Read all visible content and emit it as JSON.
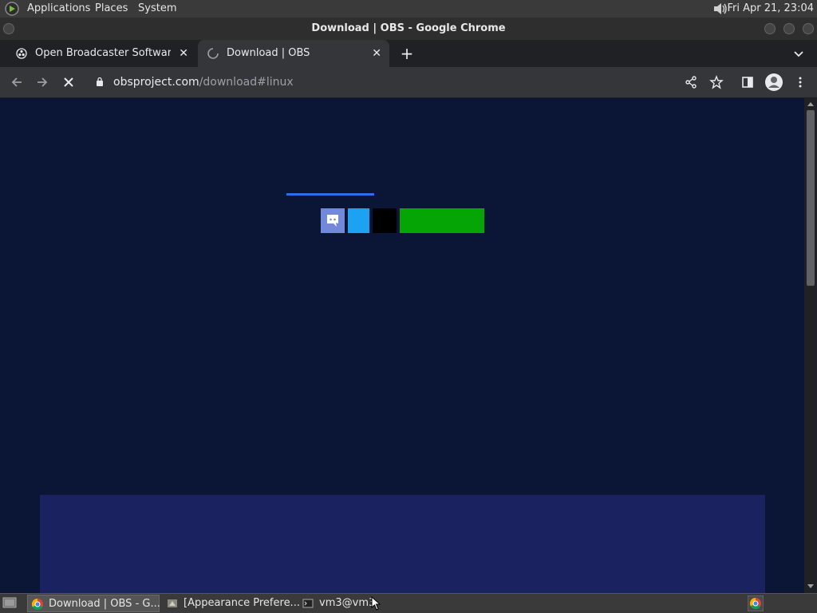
{
  "top_panel": {
    "menus": [
      "Applications",
      "Places",
      "System"
    ],
    "clock": "Fri Apr 21, 23:04"
  },
  "window": {
    "title": "Download | OBS - Google Chrome"
  },
  "tabs": [
    {
      "label": "Open Broadcaster Software | OBS",
      "icon": "obs-favicon",
      "active": false
    },
    {
      "label": "Download | OBS",
      "icon": "loading-spinner-icon",
      "active": true
    }
  ],
  "toolbar": {
    "url_host": "obsproject.com",
    "url_path": "/download#linux"
  },
  "taskbar": {
    "items": [
      {
        "label": "Download | OBS - G...",
        "icon": "chrome-icon",
        "active": true
      },
      {
        "label": "[Appearance Prefere...",
        "icon": "appearance-icon",
        "active": false
      },
      {
        "label": "vm3@vm3",
        "icon": "terminal-icon",
        "active": false
      }
    ]
  },
  "colors": {
    "page_bg": "#0b1536",
    "discord": "#7289da",
    "twitter": "#1da1f2",
    "github": "#000000",
    "download_green": "#04a504",
    "panel": "#1a2360",
    "accent_line": "#2f6fe4"
  }
}
